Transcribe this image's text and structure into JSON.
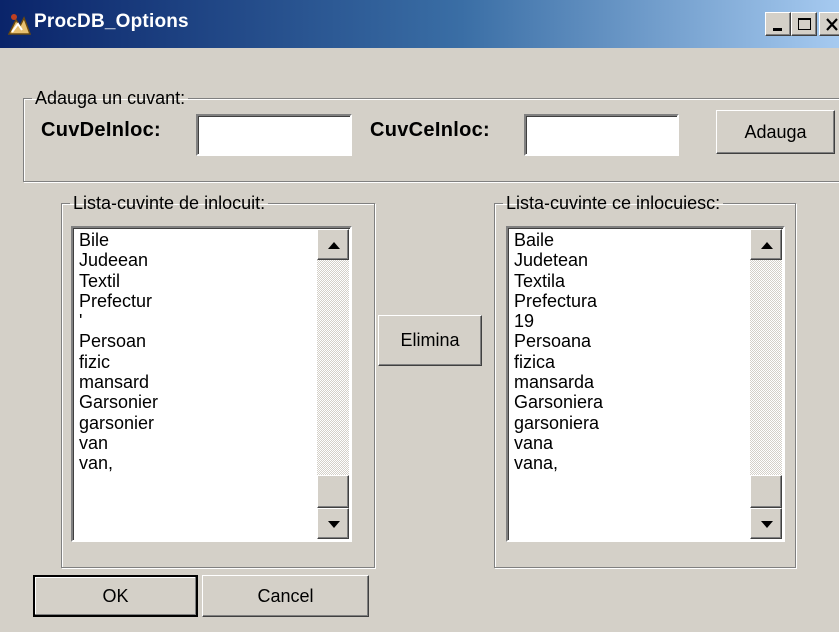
{
  "window": {
    "title": "ProcDB_Options",
    "icon": "app-icon",
    "controls": [
      "minimize-icon",
      "maximize-icon",
      "close-icon"
    ]
  },
  "add_group": {
    "legend": "Adauga un cuvant:",
    "from_label": "CuvDeInloc:",
    "from_value": "",
    "to_label": "CuvCeInloc:",
    "to_value": "",
    "add_button": "Adauga"
  },
  "left_list": {
    "legend": "Lista-cuvinte de inlocuit:",
    "items": [
      "Bile",
      "Judeean",
      "Textil",
      "Prefectur",
      "'",
      "Persoan",
      "fizic",
      "mansard",
      "Garsonier",
      "garsonier",
      "van",
      "van,"
    ]
  },
  "right_list": {
    "legend": "Lista-cuvinte ce inlocuiesc:",
    "items": [
      "Baile",
      "Judetean",
      "Textila",
      "Prefectura",
      "19",
      "Persoana",
      "fizica",
      "mansarda",
      "Garsoniera",
      "garsoniera",
      "vana",
      "vana,"
    ]
  },
  "remove_button": "Elimina",
  "ok_button": "OK",
  "cancel_button": "Cancel"
}
